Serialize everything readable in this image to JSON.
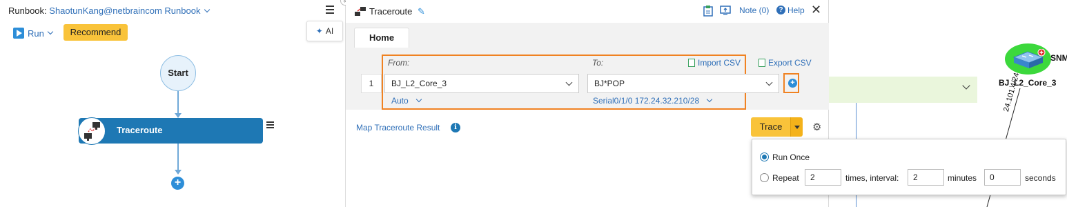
{
  "runbook": {
    "label": "Runbook:",
    "name": "ShaotunKang@netbraincom Runbook",
    "run_label": "Run",
    "recommend_label": "Recommend",
    "ai_label": "AI",
    "collapse_glyph": "«",
    "nodes": {
      "start": "Start",
      "traceroute": "Traceroute",
      "add": "+"
    }
  },
  "dialog": {
    "title": "Traceroute",
    "note_label": "Note (0)",
    "help_label": "Help",
    "help_glyph": "?",
    "close_glyph": "✕",
    "pencil_glyph": "✎",
    "tabs": [
      {
        "label": "Home",
        "active": true
      }
    ],
    "form": {
      "from_label": "From:",
      "to_label": "To:",
      "import_csv": "Import CSV",
      "export_csv": "Export CSV",
      "rows": [
        {
          "index": "1",
          "from_value": "BJ_L2_Core_3",
          "to_value": "BJ*POP",
          "from_sub": "Auto",
          "to_sub": "Serial0/1/0 172.24.32.210/28"
        }
      ],
      "add_row_glyph": "+"
    },
    "map_result_label": "Map Traceroute Result",
    "info_glyph": "i",
    "trace_label": "Trace",
    "gear_glyph": "⚙"
  },
  "run_popup": {
    "run_once_label": "Run Once",
    "run_once_selected": true,
    "repeat_label": "Repeat",
    "repeat_times": "2",
    "times_interval_label": "times, interval:",
    "interval_value": "2",
    "minutes_label": "minutes",
    "seconds_value": "0",
    "seconds_label": "seconds"
  },
  "map": {
    "device_name": "BJ_L2_Core_3",
    "snmp_label": "SNM",
    "link_label": "24.101.4/24",
    "colors": {
      "device_highlight": "#3cd83c",
      "band": "#eaf6dc",
      "link": "#5b8fd1"
    }
  },
  "colors": {
    "accent": "#2f6fb8",
    "node_fill": "#1e78b4",
    "button_yellow": "#f9c33a",
    "highlight_orange": "#f08222"
  }
}
